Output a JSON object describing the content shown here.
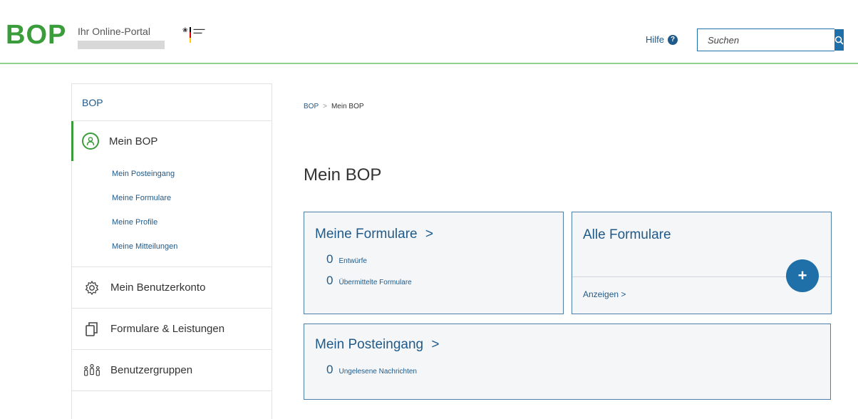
{
  "header": {
    "logo": "BOP",
    "portal_title": "Ihr Online-Portal",
    "help_label": "Hilfe",
    "search_placeholder": "Suchen"
  },
  "sidebar": {
    "root": "BOP",
    "active": "Mein BOP",
    "subitems": [
      "Mein Posteingang",
      "Meine Formulare",
      "Meine Profile",
      "Meine Mitteilungen"
    ],
    "items": [
      "Mein Benutzerkonto",
      "Formulare & Leistungen",
      "Benutzergruppen"
    ]
  },
  "breadcrumb": {
    "root": "BOP",
    "separator": ">",
    "current": "Mein BOP"
  },
  "main": {
    "title": "Mein BOP",
    "card_formulare": {
      "title": "Meine Formulare",
      "chevron": ">",
      "stats": [
        {
          "value": "0",
          "label": "Entwürfe"
        },
        {
          "value": "0",
          "label": "Übermittelte Formulare"
        }
      ]
    },
    "card_alle": {
      "title": "Alle Formulare",
      "link": "Anzeigen >",
      "button": "+"
    },
    "card_post": {
      "title": "Mein Posteingang",
      "chevron": ">",
      "stat": {
        "value": "0",
        "label": "Ungelesene Nachrichten"
      }
    }
  },
  "colors": {
    "brand_green": "#3a9c3a",
    "link_blue": "#1f5a8a",
    "button_blue": "#1f6fa8"
  }
}
